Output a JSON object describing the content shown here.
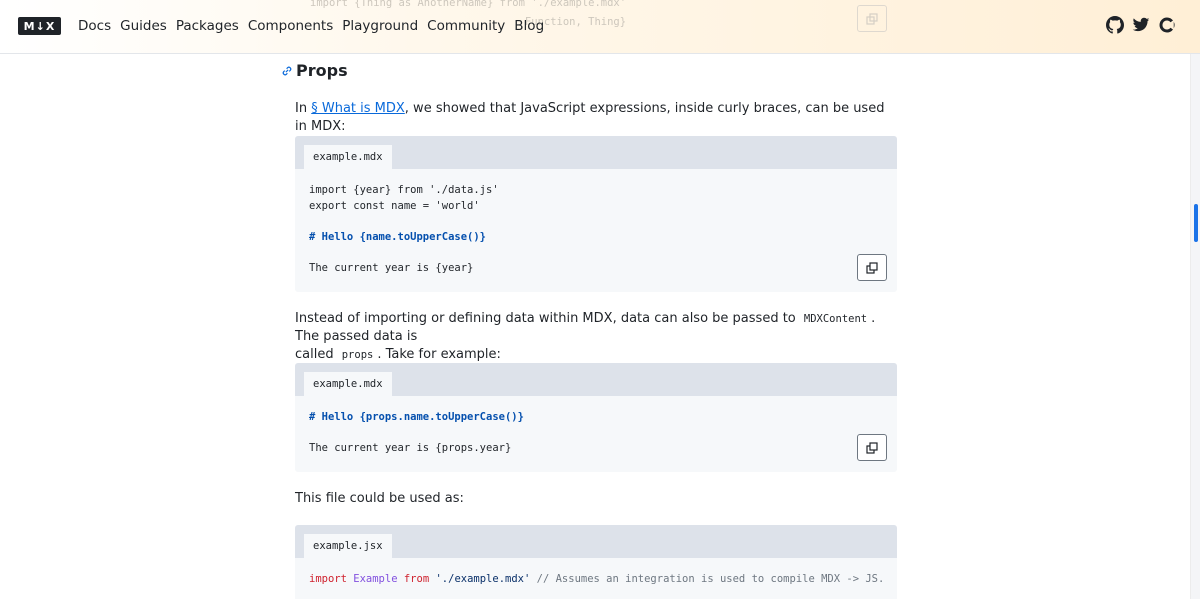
{
  "header": {
    "ghost_lines": [
      "import {Thing as AnotherName} from './example.mdx'",
      "                                  Function, Thing}"
    ],
    "logo_text": "M↓X",
    "nav": [
      "Docs",
      "Guides",
      "Packages",
      "Components",
      "Playground",
      "Community",
      "Blog"
    ],
    "icons": [
      "github-icon",
      "twitter-icon",
      "opencollective-icon"
    ]
  },
  "section": {
    "title": "Props",
    "anchor_icon": "link-icon"
  },
  "paragraph1": {
    "prefix": "In ",
    "link": "§ What is MDX",
    "suffix": ", we showed that JavaScript expressions, inside curly braces, can be used in MDX:"
  },
  "code1": {
    "filename": "example.mdx",
    "lines": [
      "import {year} from './data.js'",
      "export const name = 'world'",
      "",
      "# Hello {name.toUpperCase()}",
      "",
      "The current year is {year}"
    ]
  },
  "paragraph2": {
    "part1": "Instead of importing or defining data within MDX, data can also be passed to",
    "code1": "MDXContent",
    "part2": ". The passed data is",
    "part3": "called",
    "code2": "props",
    "part4": ". Take for example:"
  },
  "code2": {
    "filename": "example.mdx",
    "lines": [
      "# Hello {props.name.toUpperCase()}",
      "",
      "The current year is {props.year}"
    ]
  },
  "paragraph3": "This file could be used as:",
  "code3": {
    "filename": "example.jsx",
    "kw_import": "import",
    "name": "Example",
    "kw_from": "from",
    "path": "'./example.mdx'",
    "comment": "// Assumes an integration is used to compile MDX -> JS."
  },
  "colors": {
    "accent": "#0969da",
    "header_gradient_end": "#ffefd6",
    "code_bar": "#dde2ea",
    "code_bg": "#f6f8fa",
    "scroll_thumb": "#1a73e8"
  }
}
